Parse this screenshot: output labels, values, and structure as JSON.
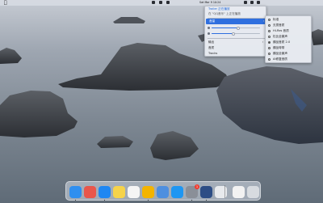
{
  "menubar": {
    "apple": "",
    "clock": "Sat Mar 9  10:24",
    "status_icons": [
      "menu-extra-icon",
      "wifi-icon",
      "control-center-icon",
      "battery-icon"
    ]
  },
  "dropdown": {
    "title": "Trailer 正在播放",
    "subtitle": "在 \"QQ音乐\" 上正在播放",
    "highlighted_item": "音量",
    "section_label": "输出",
    "tracks_label": "Tracks",
    "quality_label": "音质",
    "volume_level": 0.55,
    "brightness_level": 0.45
  },
  "submenu": {
    "items": [
      {
        "label": "标准",
        "selected": false
      },
      {
        "label": "无损音质",
        "selected": false
      },
      {
        "label": "Hi-Res 音质",
        "selected": false
      },
      {
        "label": "杜比全景声",
        "selected": false
      },
      {
        "label": "臻品音质 2.0",
        "selected": true
      },
      {
        "label": "臻品母带",
        "selected": false
      },
      {
        "label": "臻品全景声",
        "selected": false
      },
      {
        "label": "AI修复音质",
        "selected": false
      }
    ]
  },
  "dock": {
    "apps": [
      {
        "name": "finder-icon",
        "color": "#2f8ff0",
        "running": true
      },
      {
        "name": "launchpad-icon",
        "color": "#e9564b",
        "running": false
      },
      {
        "name": "safari-icon",
        "color": "#1f87f2",
        "running": true
      },
      {
        "name": "notes-icon",
        "color": "#f6d34a",
        "running": false
      },
      {
        "name": "calendar-icon",
        "color": "#f5f5f5",
        "running": false
      },
      {
        "name": "chrome-icon",
        "color": "#f4b400",
        "running": true
      },
      {
        "name": "xcode-icon",
        "color": "#4e8fdf",
        "running": false
      },
      {
        "name": "app-store-icon",
        "color": "#1e96f2",
        "running": false
      },
      {
        "name": "system-settings-icon",
        "color": "#8a8f98",
        "running": true,
        "badge": "1"
      },
      {
        "name": "music-icon",
        "color": "#2d4d85",
        "running": true
      },
      {
        "name": "printer-icon",
        "color": "#e8eaed",
        "running": false
      },
      {
        "name": "document-icon",
        "color": "#f2f2f2",
        "running": false
      },
      {
        "name": "trash-icon",
        "color": "#d7dbe0",
        "running": false
      }
    ]
  }
}
